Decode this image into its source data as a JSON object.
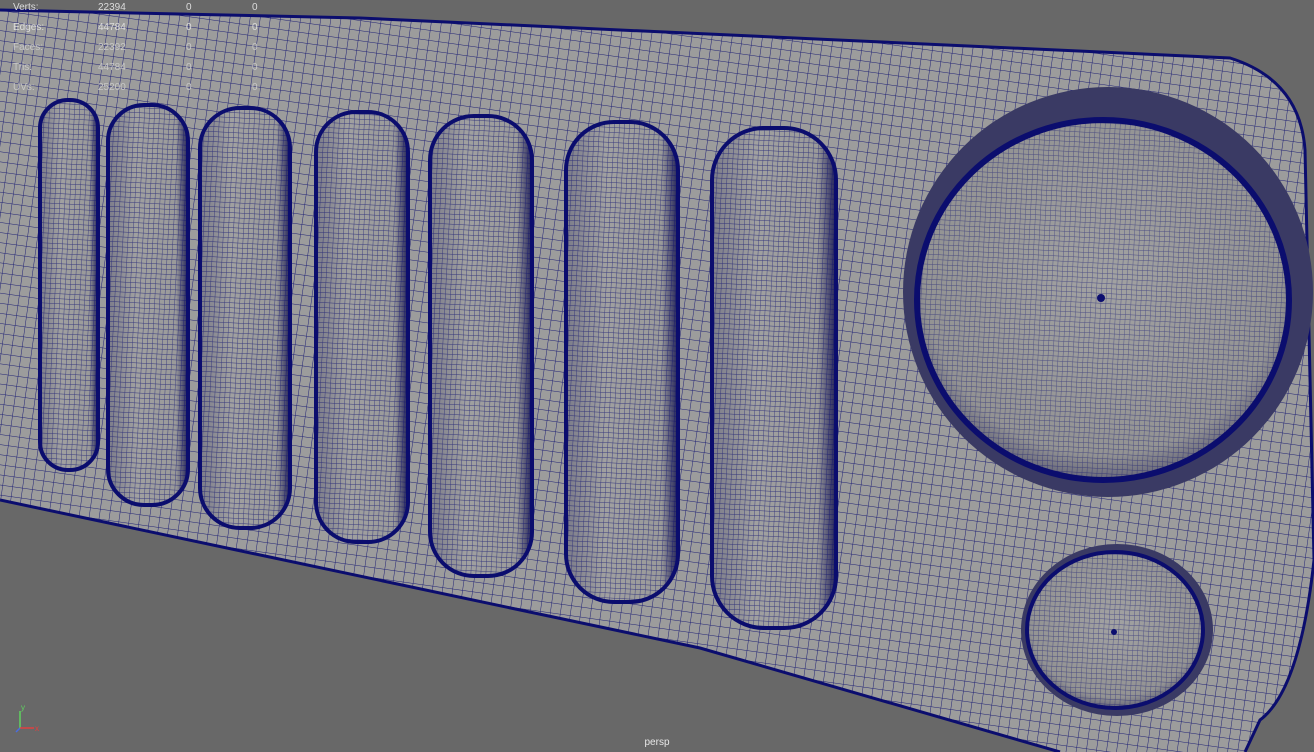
{
  "hud": {
    "rows": [
      {
        "label": "Verts:",
        "v0": "22394",
        "v1": "0",
        "v2": "0"
      },
      {
        "label": "Edges:",
        "v0": "44784",
        "v1": "0",
        "v2": "0"
      },
      {
        "label": "Faces:",
        "v0": "22392",
        "v1": "0",
        "v2": "0"
      },
      {
        "label": "Tris:",
        "v0": "44784",
        "v1": "0",
        "v2": "0"
      },
      {
        "label": "UVs:",
        "v0": "25200",
        "v1": "0",
        "v2": "0"
      }
    ]
  },
  "viewport": {
    "camera": "persp",
    "background_color": "#686868",
    "mesh_fill_color": "#9c9c9c",
    "wire_color": "#0b0d6e",
    "object": "grille-mesh"
  },
  "axis": {
    "y": "y",
    "x": "x",
    "icon": "axis-gizmo-icon"
  }
}
